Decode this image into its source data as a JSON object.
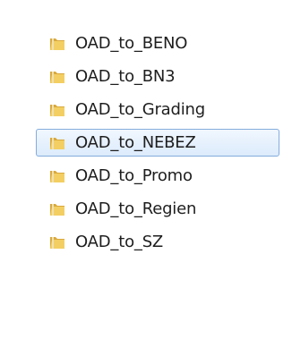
{
  "folders": [
    {
      "label": "OAD_to_BENO",
      "selected": false
    },
    {
      "label": "OAD_to_BN3",
      "selected": false
    },
    {
      "label": "OAD_to_Grading",
      "selected": false
    },
    {
      "label": "OAD_to_NEBEZ",
      "selected": true
    },
    {
      "label": "OAD_to_Promo",
      "selected": false
    },
    {
      "label": "OAD_to_Regien",
      "selected": false
    },
    {
      "label": "OAD_to_SZ",
      "selected": false
    }
  ],
  "icon": "folder-icon",
  "colors": {
    "selection_border": "#84acdd",
    "selection_fill_top": "#f1f7fe",
    "selection_fill_bottom": "#dcebfc",
    "folder_yellow": "#f3cf63",
    "text": "#1e1e1e"
  }
}
